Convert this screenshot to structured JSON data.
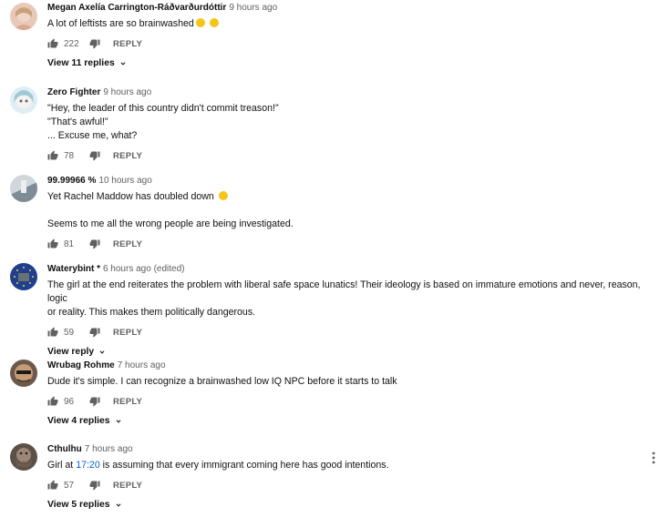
{
  "comments": [
    {
      "author": "Megan Axelía Carrington-Ráðvarðurdóttir",
      "time": "9 hours ago",
      "lines": [
        "A lot of leftists are so brainwashed"
      ],
      "emojis": [
        "😔",
        "😉"
      ],
      "likes": "222",
      "reply_label": "REPLY",
      "view_replies": "View 11 replies"
    },
    {
      "author": "Zero Fighter",
      "time": "9 hours ago",
      "lines": [
        "\"Hey, the leader of this country didn't commit treason!\"",
        "\"That's awful!\"",
        "... Excuse me, what?"
      ],
      "likes": "78",
      "reply_label": "REPLY"
    },
    {
      "author": "99.99966 %",
      "time": "10 hours ago",
      "lines": [
        "Yet Rachel Maddow has doubled down",
        "",
        "Seems to me all the wrong people are being investigated."
      ],
      "emojis": [
        "🤔"
      ],
      "likes": "81",
      "reply_label": "REPLY"
    },
    {
      "author": "Waterybint *",
      "time": "6 hours ago (edited)",
      "lines": [
        "The girl at the end reiterates the problem with liberal safe space lunatics! Their ideology is based on immature emotions and never, reason, logic",
        "or reality. This makes them politically dangerous."
      ],
      "likes": "59",
      "reply_label": "REPLY",
      "view_replies": "View reply"
    },
    {
      "author": "Wrubag Rohme",
      "time": "7 hours ago",
      "lines": [
        "Dude it's simple. I can recognize a brainwashed low IQ NPC before it starts to talk"
      ],
      "likes": "96",
      "reply_label": "REPLY",
      "view_replies": "View 4 replies"
    },
    {
      "author": "Cthulhu",
      "time": "7 hours ago",
      "text_before_link": "Girl at ",
      "link": "17:20",
      "text_after_link": " is assuming that every immigrant coming here has good intentions.",
      "likes": "57",
      "reply_label": "REPLY",
      "view_replies": "View 5 replies"
    }
  ],
  "colors": {
    "link": "#065fd4",
    "secondary_text": "#606060"
  }
}
